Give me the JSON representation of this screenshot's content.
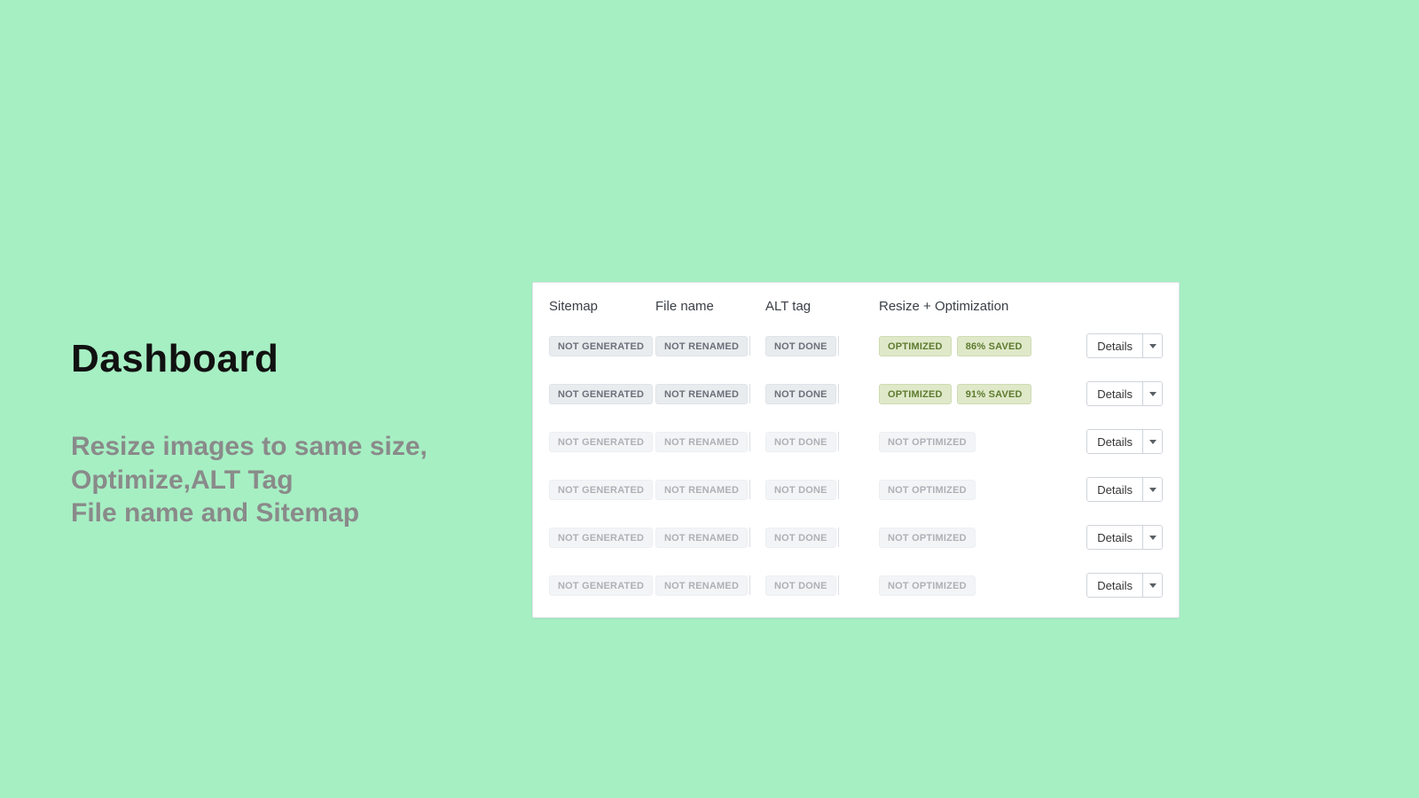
{
  "left": {
    "title": "Dashboard",
    "subtitle_line1": "Resize images to same size,",
    "subtitle_line2": "Optimize,ALT Tag",
    "subtitle_line3": "File name and Sitemap"
  },
  "table": {
    "headers": {
      "sitemap": "Sitemap",
      "filename": "File name",
      "alt": "ALT tag",
      "resize": "Resize + Optimization"
    },
    "details_label": "Details",
    "rows": [
      {
        "sitemap": "NOT GENERATED",
        "filename": "NOT RENAMED",
        "alt": "NOT DONE",
        "optimized": true,
        "optimized_label": "OPTIMIZED",
        "saved": "86% SAVED",
        "faded": false
      },
      {
        "sitemap": "NOT GENERATED",
        "filename": "NOT RENAMED",
        "alt": "NOT DONE",
        "optimized": true,
        "optimized_label": "OPTIMIZED",
        "saved": "91% SAVED",
        "faded": false
      },
      {
        "sitemap": "NOT GENERATED",
        "filename": "NOT RENAMED",
        "alt": "NOT DONE",
        "optimized": false,
        "optimized_label": "NOT OPTIMIZED",
        "saved": "",
        "faded": true
      },
      {
        "sitemap": "NOT GENERATED",
        "filename": "NOT RENAMED",
        "alt": "NOT DONE",
        "optimized": false,
        "optimized_label": "NOT OPTIMIZED",
        "saved": "",
        "faded": true
      },
      {
        "sitemap": "NOT GENERATED",
        "filename": "NOT RENAMED",
        "alt": "NOT DONE",
        "optimized": false,
        "optimized_label": "NOT OPTIMIZED",
        "saved": "",
        "faded": true
      },
      {
        "sitemap": "NOT GENERATED",
        "filename": "NOT RENAMED",
        "alt": "NOT DONE",
        "optimized": false,
        "optimized_label": "NOT OPTIMIZED",
        "saved": "",
        "faded": true
      }
    ]
  }
}
